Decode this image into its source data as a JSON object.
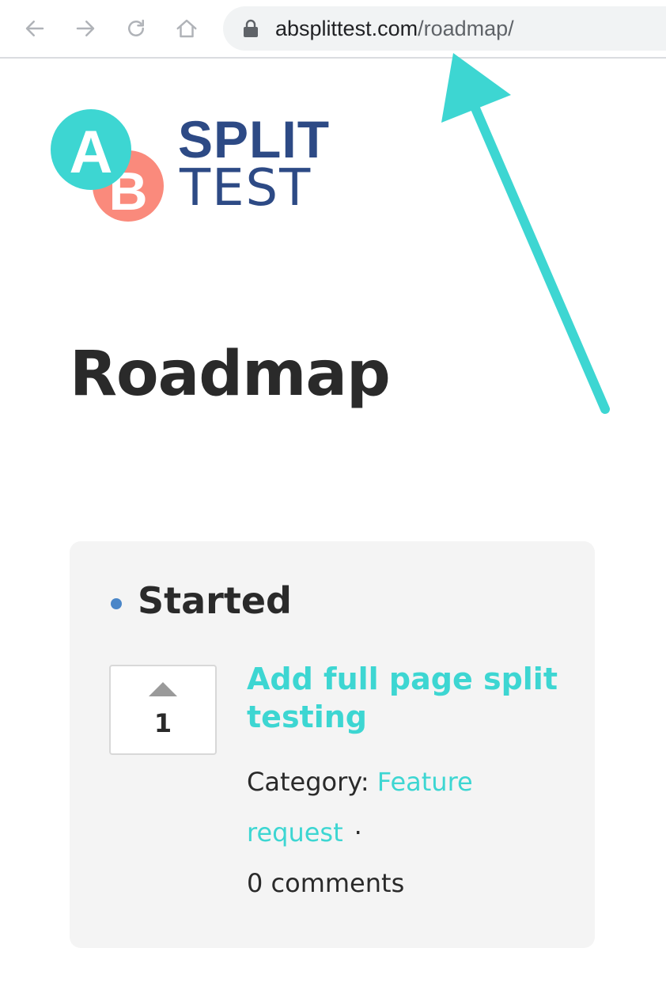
{
  "browser": {
    "url_domain": "absplittest.com",
    "url_path": "/roadmap/",
    "icons": [
      "back-arrow-icon",
      "forward-arrow-icon",
      "reload-icon",
      "home-icon",
      "lock-icon"
    ]
  },
  "logo": {
    "letter_a": "A",
    "letter_b": "B",
    "word_split": "SPLIT",
    "word_test": "TEST",
    "colors": {
      "a_circle": "#3dd6d2",
      "b_circle": "#fa8a7c",
      "text": "#2d4a85"
    }
  },
  "page": {
    "title": "Roadmap"
  },
  "roadmap": {
    "status": "Started",
    "status_color": "#4a86c8",
    "item": {
      "vote_count": "1",
      "title": "Add full page split testing",
      "category_label": "Category:",
      "category_value": "Feature request",
      "separator": "·",
      "comments": "0 comments"
    }
  },
  "annotation": {
    "arrow_color": "#3dd6d2"
  }
}
